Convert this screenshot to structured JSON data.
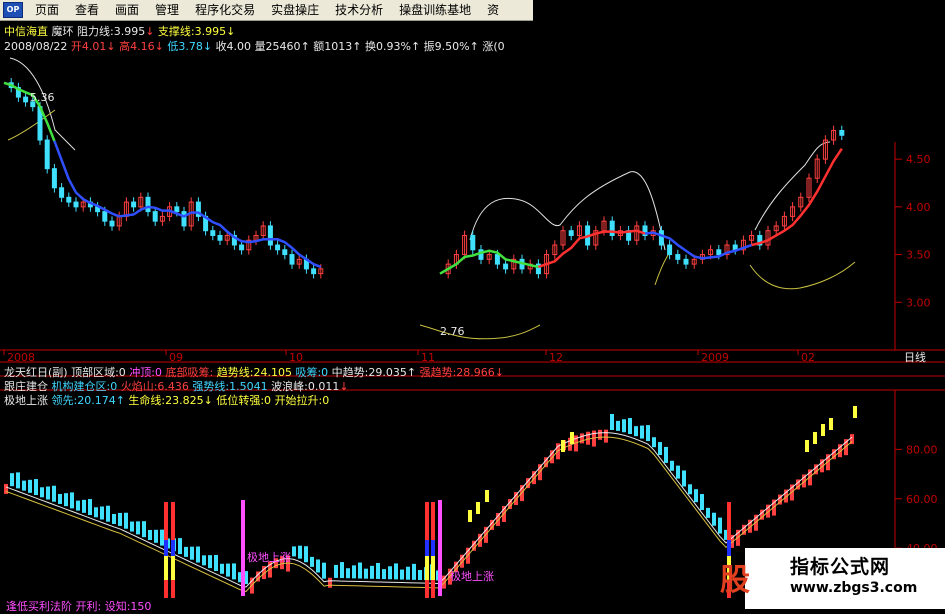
{
  "menu": {
    "logo": "OP",
    "items": [
      "页面",
      "查看",
      "画面",
      "管理",
      "程序化交易",
      "实盘操庄",
      "技术分析",
      "操盘训练基地",
      "资"
    ]
  },
  "info": {
    "stock_name": "中信海直",
    "indicator_name": "魔环",
    "resistance": "阻力线:3.995",
    "support": "支撑线:3.995",
    "date": "2008/08/22",
    "open": "开4.01",
    "high": "高4.16",
    "low": "低3.78",
    "close": "收4.00",
    "volume": "量25460",
    "amount": "额1013",
    "turnover": "换0.93%",
    "amplitude": "振9.50%",
    "change": "涨(0"
  },
  "price_chart": {
    "y_ticks": [
      "4.50",
      "4.00",
      "3.50",
      "3.00"
    ],
    "y_values": [
      4.5,
      4.0,
      3.5,
      3.0
    ],
    "ylim": [
      2.5,
      4.91
    ],
    "x_labels": [
      "2008",
      "09",
      "10",
      "11",
      "12",
      "2009",
      "02"
    ],
    "period_label": "日线",
    "high_note": "5.36",
    "low_note": "2.76"
  },
  "indicator": {
    "title": "龙天红日(副)",
    "top_zone": "顶部区域:0",
    "chong_ding": "冲顶:0",
    "bottom_absorb": "底部吸筹:",
    "trend_line": "趋势线:24.105",
    "fengding": "吸筹:0",
    "mid_trend": "中趋势:29.035",
    "long_trend": "强趋势:28.966",
    "follow_build": "跟庄建仓",
    "inst_zone": "机构建仓区:0",
    "fire_mountain": "火焰山:6.436",
    "strength_line": "强势线:1.5041",
    "wave_peak": "波浪峰:0.011",
    "extreme_rise": "极地上涨",
    "lead": "领先:20.174",
    "life_line": "生命线:23.825",
    "low_turn": "低位转强:0",
    "start_pull": "开始拉升:0",
    "y_ticks": [
      "80.00",
      "60.00",
      "40.00"
    ],
    "y_values": [
      80,
      60,
      40
    ],
    "ylim": [
      19,
      100
    ],
    "annot1": "极地上涨",
    "annot2": "极地上涨"
  },
  "bottom_text": "逢低买利法阶   开利:   设知:150",
  "watermark": {
    "big": "股",
    "title": "指标公式网",
    "url": "www.zbgs3.com"
  },
  "colors": {
    "up": "#ff4040",
    "down": "#40e0ff",
    "ma_red": "#ff3030",
    "ma_blue": "#3050ff",
    "ma_green": "#40e040",
    "band_white": "#e0e0e0",
    "band_yellow": "#c8c040",
    "axis_red": "#c00000",
    "magenta": "#ff50ff",
    "yellow": "#ffff40"
  },
  "chart_data": {
    "type": "line",
    "title": "中信海直 日线",
    "ylim": [
      2.5,
      4.91
    ],
    "close_series": [
      5.3,
      5.25,
      5.15,
      5.1,
      5.05,
      4.7,
      4.4,
      4.2,
      4.1,
      4.05,
      4.0,
      4.05,
      4.0,
      3.95,
      3.85,
      3.8,
      3.9,
      4.05,
      4.0,
      4.1,
      3.95,
      3.85,
      3.9,
      4.0,
      3.95,
      3.8,
      4.05,
      3.9,
      3.75,
      3.7,
      3.65,
      3.7,
      3.6,
      3.55,
      3.65,
      3.7,
      3.8,
      3.6,
      3.55,
      3.5,
      3.4,
      3.45,
      3.35,
      3.3,
      3.35
    ],
    "close_series_2": [
      3.3,
      3.4,
      3.5,
      3.7,
      3.55,
      3.45,
      3.5,
      3.4,
      3.35,
      3.45,
      3.35,
      3.4,
      3.3,
      3.5,
      3.6,
      3.75,
      3.7,
      3.8,
      3.6,
      3.75,
      3.85,
      3.7,
      3.75,
      3.65,
      3.8,
      3.7,
      3.75,
      3.6,
      3.5,
      3.45,
      3.4,
      3.45,
      3.5,
      3.55,
      3.5,
      3.6,
      3.55,
      3.65,
      3.7,
      3.6,
      3.75,
      3.8,
      3.9,
      4.0,
      4.1,
      4.3,
      4.5,
      4.7,
      4.8,
      4.75
    ]
  }
}
